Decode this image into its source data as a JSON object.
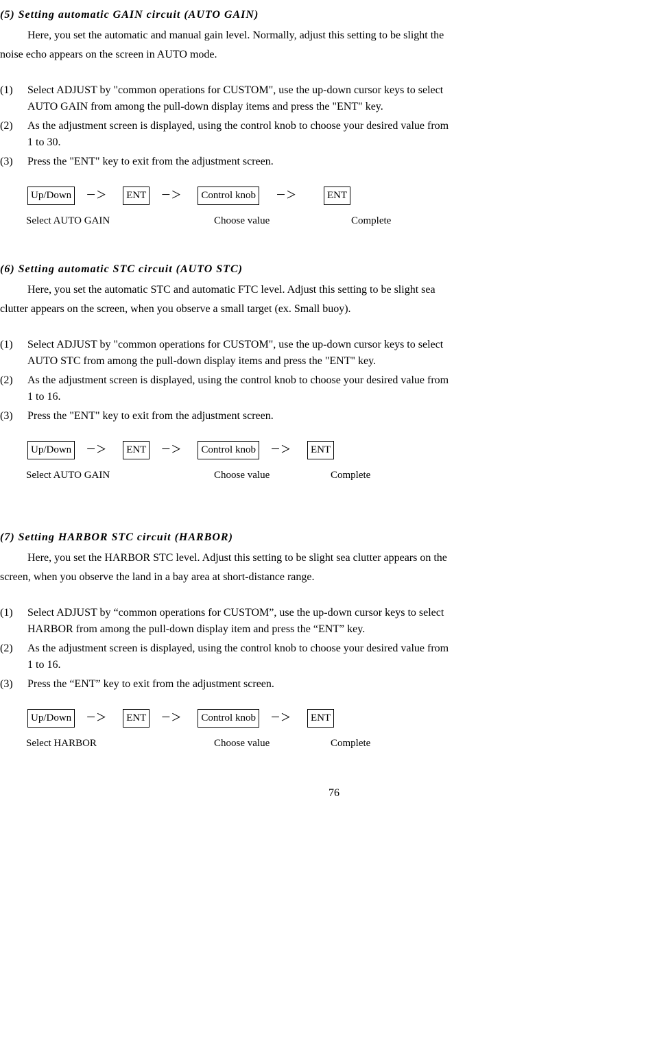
{
  "sections": [
    {
      "title": "(5) Setting automatic GAIN circuit (AUTO GAIN)",
      "intro1": "Here, you set the automatic and manual gain level. Normally, adjust this setting to be slight the",
      "intro2": "noise echo appears on the screen in AUTO mode.",
      "items": [
        {
          "num": "(1)",
          "line1": "Select ADJUST by \"common operations for CUSTOM\", use the up-down cursor keys to select",
          "line2": "AUTO GAIN from among the pull-down display items and press the \"ENT\" key."
        },
        {
          "num": "(2)",
          "line1": "As the adjustment screen is displayed, using the control knob to choose your desired value from",
          "line2": "1 to 30."
        },
        {
          "num": "(3)",
          "line1": "Press the \"ENT\" key to exit from the adjustment screen.",
          "line2": ""
        }
      ],
      "flow": {
        "b1": "Up/Down",
        "b2": "ENT",
        "b3": "Control knob",
        "b4": "ENT",
        "arrow": "－＞",
        "l1": "Select AUTO GAIN",
        "l2": "Choose value",
        "l3": "Complete",
        "wide": true
      }
    },
    {
      "title": "(6) Setting automatic STC circuit (AUTO STC)",
      "intro1": "Here, you set the automatic STC and automatic FTC level. Adjust this setting to be slight sea",
      "intro2": "clutter appears on the screen, when you observe a small target (ex. Small buoy).",
      "items": [
        {
          "num": "(1)",
          "line1": "Select ADJUST by \"common operations for CUSTOM\", use the up-down cursor keys to select",
          "line2": "AUTO STC from among the pull-down display items and press the \"ENT\" key."
        },
        {
          "num": "(2)",
          "line1": "As the adjustment screen is displayed, using the control knob to choose your desired value from",
          "line2": "1 to 16."
        },
        {
          "num": "(3)",
          "line1": "Press the \"ENT\" key to exit from the adjustment screen.",
          "line2": ""
        }
      ],
      "flow": {
        "b1": "Up/Down",
        "b2": "ENT",
        "b3": "Control knob",
        "b4": "ENT",
        "arrow": "－＞",
        "l1": "Select AUTO GAIN",
        "l2": "Choose value",
        "l3": "Complete",
        "wide": false
      }
    },
    {
      "title": "(7) Setting HARBOR STC circuit (HARBOR)",
      "intro1": "Here, you set the HARBOR STC level. Adjust this setting to be slight sea clutter appears on the",
      "intro2": "screen, when you observe the land in a bay area at short-distance range.",
      "items": [
        {
          "num": "(1)",
          "line1": "Select ADJUST by “common operations for CUSTOM”, use the up-down cursor keys to select",
          "line2": "HARBOR from among the pull-down display item and press the “ENT” key."
        },
        {
          "num": "(2)",
          "line1": "As the adjustment screen is displayed, using the control knob to choose your desired value from",
          "line2": "1 to 16."
        },
        {
          "num": "(3)",
          "line1": "Press the “ENT” key to exit from the adjustment screen.",
          "line2": ""
        }
      ],
      "flow": {
        "b1": "Up/Down",
        "b2": "ENT",
        "b3": "Control knob",
        "b4": "ENT",
        "arrow": "－＞",
        "l1": "Select HARBOR",
        "l2": "Choose value",
        "l3": "Complete",
        "wide": false
      }
    }
  ],
  "page_number": "76"
}
